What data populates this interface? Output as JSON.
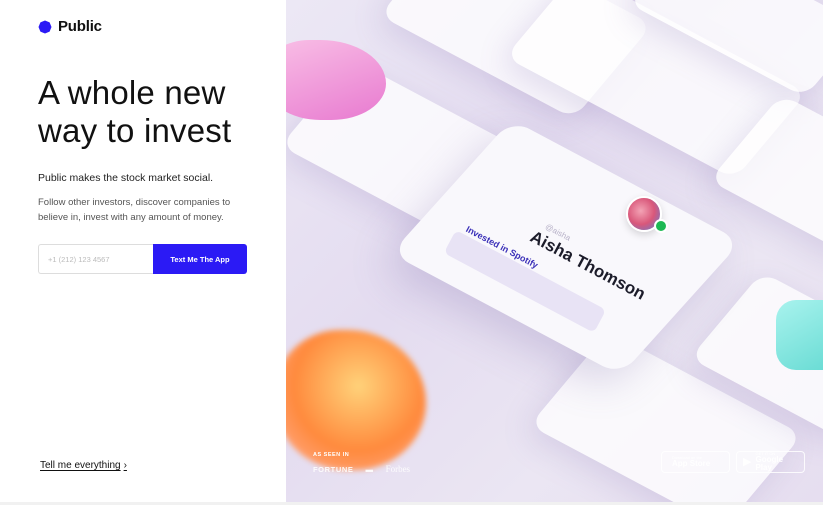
{
  "brand": {
    "name": "Public",
    "color": "#2b1af5"
  },
  "hero_text": {
    "headline": "A whole new way to invest",
    "lead": "Public makes the stock market social.",
    "body": "Follow other investors, discover companies to believe in, invest with any amount of money."
  },
  "signup": {
    "phone_placeholder": "+1 (212) 123 4567",
    "button_label": "Text Me The App",
    "button_color": "#2b1af5"
  },
  "footer_link": {
    "label": "Tell me everything",
    "chevron": "›"
  },
  "showcase": {
    "profile_name": "Aisha Thomson",
    "profile_handle": "@aisha",
    "invested_text": "Invested in Spotify"
  },
  "press": {
    "heading": "AS SEEN IN",
    "outlets": [
      "FORTUNE",
      "Forbes"
    ]
  },
  "app_stores": [
    {
      "icon": "apple-icon",
      "small": "Download on the",
      "big": "App Store"
    },
    {
      "icon": "google-play-icon",
      "small": "GET IT ON",
      "big": "Google Play"
    }
  ]
}
